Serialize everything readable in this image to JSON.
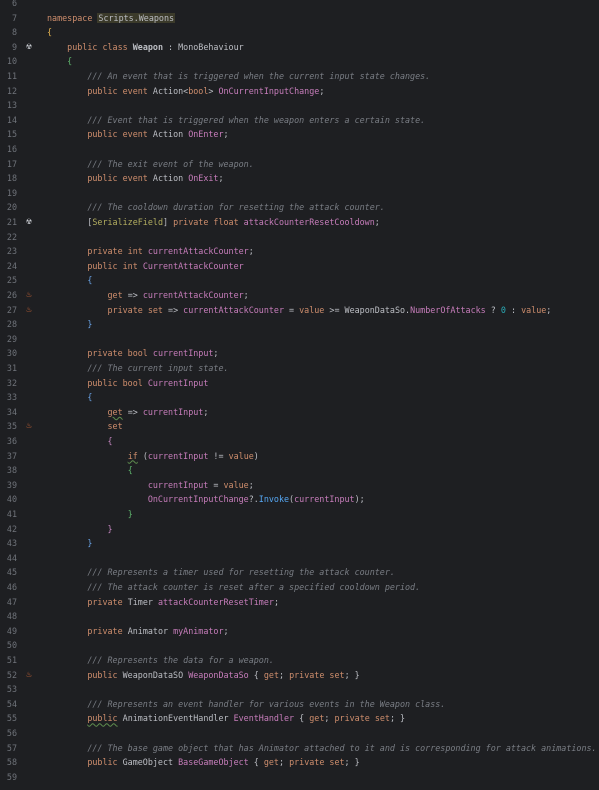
{
  "editor": {
    "lines": [
      {
        "n": "6",
        "icon": "",
        "tokens": []
      },
      {
        "n": "7",
        "icon": "",
        "tokens": [
          [
            "kw",
            "namespace "
          ],
          [
            "ns",
            "Scripts.Weapons"
          ]
        ]
      },
      {
        "n": "8",
        "icon": "",
        "tokens": [
          [
            "brace-y",
            "{"
          ]
        ]
      },
      {
        "n": "9",
        "icon": "unity",
        "tokens": [
          [
            "",
            "    "
          ],
          [
            "kw",
            "public class "
          ],
          [
            "cls",
            "Weapon"
          ],
          [
            "",
            " : "
          ],
          [
            "type",
            "MonoBehaviour"
          ]
        ]
      },
      {
        "n": "10",
        "icon": "",
        "tokens": [
          [
            "",
            "    "
          ],
          [
            "brace-g",
            "{"
          ]
        ]
      },
      {
        "n": "11",
        "icon": "",
        "tokens": [
          [
            "",
            "        "
          ],
          [
            "cmt",
            "/// An event that is triggered when the current input state changes."
          ]
        ]
      },
      {
        "n": "12",
        "icon": "",
        "tokens": [
          [
            "",
            "        "
          ],
          [
            "kw",
            "public event "
          ],
          [
            "type",
            "Action<"
          ],
          [
            "kw",
            "bool"
          ],
          [
            "type",
            "> "
          ],
          [
            "evt",
            "OnCurrentInputChange"
          ],
          [
            "",
            ";"
          ]
        ]
      },
      {
        "n": "13",
        "icon": "",
        "tokens": []
      },
      {
        "n": "14",
        "icon": "",
        "tokens": [
          [
            "",
            "        "
          ],
          [
            "cmt",
            "/// Event that is triggered when the weapon enters a certain state."
          ]
        ]
      },
      {
        "n": "15",
        "icon": "",
        "tokens": [
          [
            "",
            "        "
          ],
          [
            "kw",
            "public event "
          ],
          [
            "type",
            "Action "
          ],
          [
            "evt",
            "OnEnter"
          ],
          [
            "",
            ";"
          ]
        ]
      },
      {
        "n": "16",
        "icon": "",
        "tokens": []
      },
      {
        "n": "17",
        "icon": "",
        "tokens": [
          [
            "",
            "        "
          ],
          [
            "cmt",
            "/// The exit event of the weapon."
          ]
        ]
      },
      {
        "n": "18",
        "icon": "",
        "tokens": [
          [
            "",
            "        "
          ],
          [
            "kw",
            "public event "
          ],
          [
            "type",
            "Action "
          ],
          [
            "evt",
            "OnExit"
          ],
          [
            "",
            ";"
          ]
        ]
      },
      {
        "n": "19",
        "icon": "",
        "tokens": []
      },
      {
        "n": "20",
        "icon": "",
        "tokens": [
          [
            "",
            "        "
          ],
          [
            "cmt",
            "/// The cooldown duration for resetting the attack counter."
          ]
        ]
      },
      {
        "n": "21",
        "icon": "unity",
        "tokens": [
          [
            "",
            "        "
          ],
          [
            "",
            "["
          ],
          [
            "attr",
            "SerializeField"
          ],
          [
            "",
            "] "
          ],
          [
            "kw",
            "private float "
          ],
          [
            "fld",
            "attackCounterResetCooldown"
          ],
          [
            "",
            ";"
          ]
        ]
      },
      {
        "n": "22",
        "icon": "",
        "tokens": []
      },
      {
        "n": "23",
        "icon": "",
        "tokens": [
          [
            "",
            "        "
          ],
          [
            "kw",
            "private int "
          ],
          [
            "fld",
            "currentAttackCounter"
          ],
          [
            "",
            ";"
          ]
        ]
      },
      {
        "n": "24",
        "icon": "",
        "tokens": [
          [
            "",
            "        "
          ],
          [
            "kw",
            "public int "
          ],
          [
            "prop",
            "CurrentAttackCounter"
          ]
        ]
      },
      {
        "n": "25",
        "icon": "",
        "tokens": [
          [
            "",
            "        "
          ],
          [
            "brace-b",
            "{"
          ]
        ]
      },
      {
        "n": "26",
        "icon": "fire",
        "tokens": [
          [
            "",
            "            "
          ],
          [
            "kw",
            "get"
          ],
          [
            "",
            " => "
          ],
          [
            "fld",
            "currentAttackCounter"
          ],
          [
            "",
            ";"
          ]
        ]
      },
      {
        "n": "27",
        "icon": "fire",
        "tokens": [
          [
            "",
            "            "
          ],
          [
            "kw",
            "private set"
          ],
          [
            "",
            " => "
          ],
          [
            "fld",
            "currentAttackCounter"
          ],
          [
            "",
            " = "
          ],
          [
            "kw",
            "value"
          ],
          [
            "",
            " >= "
          ],
          [
            "type",
            "WeaponDataSo"
          ],
          [
            "",
            "."
          ],
          [
            "prop",
            "NumberOfAttacks"
          ],
          [
            "",
            " ? "
          ],
          [
            "num",
            "0"
          ],
          [
            "",
            " : "
          ],
          [
            "kw",
            "value"
          ],
          [
            "",
            ";"
          ]
        ]
      },
      {
        "n": "28",
        "icon": "",
        "tokens": [
          [
            "",
            "        "
          ],
          [
            "brace-b",
            "}"
          ]
        ]
      },
      {
        "n": "29",
        "icon": "",
        "tokens": []
      },
      {
        "n": "30",
        "icon": "",
        "tokens": [
          [
            "",
            "        "
          ],
          [
            "kw",
            "private bool "
          ],
          [
            "fld",
            "currentInput"
          ],
          [
            "",
            ";"
          ]
        ]
      },
      {
        "n": "31",
        "icon": "",
        "tokens": [
          [
            "",
            "        "
          ],
          [
            "cmt",
            "/// The current input state."
          ]
        ]
      },
      {
        "n": "32",
        "icon": "",
        "tokens": [
          [
            "",
            "        "
          ],
          [
            "kw",
            "public bool "
          ],
          [
            "prop",
            "CurrentInput"
          ]
        ]
      },
      {
        "n": "33",
        "icon": "",
        "tokens": [
          [
            "",
            "        "
          ],
          [
            "brace-b",
            "{"
          ]
        ]
      },
      {
        "n": "34",
        "icon": "",
        "tokens": [
          [
            "",
            "            "
          ],
          [
            "kw ul",
            "get"
          ],
          [
            "",
            " => "
          ],
          [
            "fld",
            "currentInput"
          ],
          [
            "",
            ";"
          ]
        ]
      },
      {
        "n": "35",
        "icon": "fire",
        "tokens": [
          [
            "",
            "            "
          ],
          [
            "kw",
            "set"
          ]
        ]
      },
      {
        "n": "36",
        "icon": "",
        "tokens": [
          [
            "",
            "            "
          ],
          [
            "brace-p",
            "{"
          ]
        ]
      },
      {
        "n": "37",
        "icon": "",
        "tokens": [
          [
            "",
            "                "
          ],
          [
            "kw ul",
            "if"
          ],
          [
            "",
            " ("
          ],
          [
            "fld",
            "currentInput"
          ],
          [
            "",
            " != "
          ],
          [
            "kw",
            "value"
          ],
          [
            "",
            ")"
          ]
        ]
      },
      {
        "n": "38",
        "icon": "",
        "tokens": [
          [
            "",
            "                "
          ],
          [
            "brace-g",
            "{"
          ]
        ]
      },
      {
        "n": "39",
        "icon": "",
        "tokens": [
          [
            "",
            "                    "
          ],
          [
            "fld",
            "currentInput"
          ],
          [
            "",
            " = "
          ],
          [
            "kw",
            "value"
          ],
          [
            "",
            ";"
          ]
        ]
      },
      {
        "n": "40",
        "icon": "",
        "tokens": [
          [
            "",
            "                    "
          ],
          [
            "evt",
            "OnCurrentInputChange"
          ],
          [
            "",
            "?."
          ],
          [
            "mth",
            "Invoke"
          ],
          [
            "",
            "("
          ],
          [
            "fld",
            "currentInput"
          ],
          [
            "",
            ");"
          ]
        ]
      },
      {
        "n": "41",
        "icon": "",
        "tokens": [
          [
            "",
            "                "
          ],
          [
            "brace-g",
            "}"
          ]
        ]
      },
      {
        "n": "42",
        "icon": "",
        "tokens": [
          [
            "",
            "            "
          ],
          [
            "brace-p",
            "}"
          ]
        ]
      },
      {
        "n": "43",
        "icon": "",
        "tokens": [
          [
            "",
            "        "
          ],
          [
            "brace-b",
            "}"
          ]
        ]
      },
      {
        "n": "44",
        "icon": "",
        "tokens": []
      },
      {
        "n": "45",
        "icon": "",
        "tokens": [
          [
            "",
            "        "
          ],
          [
            "cmt",
            "/// Represents a timer used for resetting the attack counter."
          ]
        ]
      },
      {
        "n": "46",
        "icon": "",
        "tokens": [
          [
            "",
            "        "
          ],
          [
            "cmt",
            "/// The attack counter is reset after a specified cooldown period."
          ]
        ]
      },
      {
        "n": "47",
        "icon": "",
        "tokens": [
          [
            "",
            "        "
          ],
          [
            "kw",
            "private "
          ],
          [
            "type",
            "Timer "
          ],
          [
            "fld",
            "attackCounterResetTimer"
          ],
          [
            "",
            ";"
          ]
        ]
      },
      {
        "n": "48",
        "icon": "",
        "tokens": []
      },
      {
        "n": "49",
        "icon": "",
        "tokens": [
          [
            "",
            "        "
          ],
          [
            "kw",
            "private "
          ],
          [
            "type",
            "Animator "
          ],
          [
            "fld",
            "myAnimator"
          ],
          [
            "",
            ";"
          ]
        ]
      },
      {
        "n": "50",
        "icon": "",
        "tokens": []
      },
      {
        "n": "51",
        "icon": "",
        "tokens": [
          [
            "",
            "        "
          ],
          [
            "cmt",
            "/// Represents the data for a weapon."
          ]
        ]
      },
      {
        "n": "52",
        "icon": "fire",
        "tokens": [
          [
            "",
            "        "
          ],
          [
            "kw",
            "public "
          ],
          [
            "type",
            "WeaponDataSO "
          ],
          [
            "prop",
            "WeaponDataSo"
          ],
          [
            "",
            " { "
          ],
          [
            "kw",
            "get"
          ],
          [
            "",
            "; "
          ],
          [
            "kw",
            "private set"
          ],
          [
            "",
            "; }"
          ]
        ]
      },
      {
        "n": "53",
        "icon": "",
        "tokens": []
      },
      {
        "n": "54",
        "icon": "",
        "tokens": [
          [
            "",
            "        "
          ],
          [
            "cmt",
            "/// Represents an event handler for various events in the Weapon class."
          ]
        ]
      },
      {
        "n": "55",
        "icon": "",
        "tokens": [
          [
            "",
            "        "
          ],
          [
            "kw ul",
            "public"
          ],
          [
            "",
            ""
          ],
          [
            "type",
            " AnimationEventHandler "
          ],
          [
            "prop",
            "EventHandler"
          ],
          [
            "",
            " { "
          ],
          [
            "kw",
            "get"
          ],
          [
            "",
            "; "
          ],
          [
            "kw",
            "private set"
          ],
          [
            "",
            "; }"
          ]
        ]
      },
      {
        "n": "56",
        "icon": "",
        "tokens": []
      },
      {
        "n": "57",
        "icon": "",
        "tokens": [
          [
            "",
            "        "
          ],
          [
            "cmt",
            "/// The base game object that has Animator attached to it and is corresponding for attack animations."
          ]
        ]
      },
      {
        "n": "58",
        "icon": "",
        "tokens": [
          [
            "",
            "        "
          ],
          [
            "kw",
            "public "
          ],
          [
            "type",
            "GameObject "
          ],
          [
            "prop",
            "BaseGameObject"
          ],
          [
            "",
            " { "
          ],
          [
            "kw",
            "get"
          ],
          [
            "",
            "; "
          ],
          [
            "kw",
            "private set"
          ],
          [
            "",
            "; }"
          ]
        ]
      },
      {
        "n": "59",
        "icon": "",
        "tokens": []
      }
    ]
  }
}
